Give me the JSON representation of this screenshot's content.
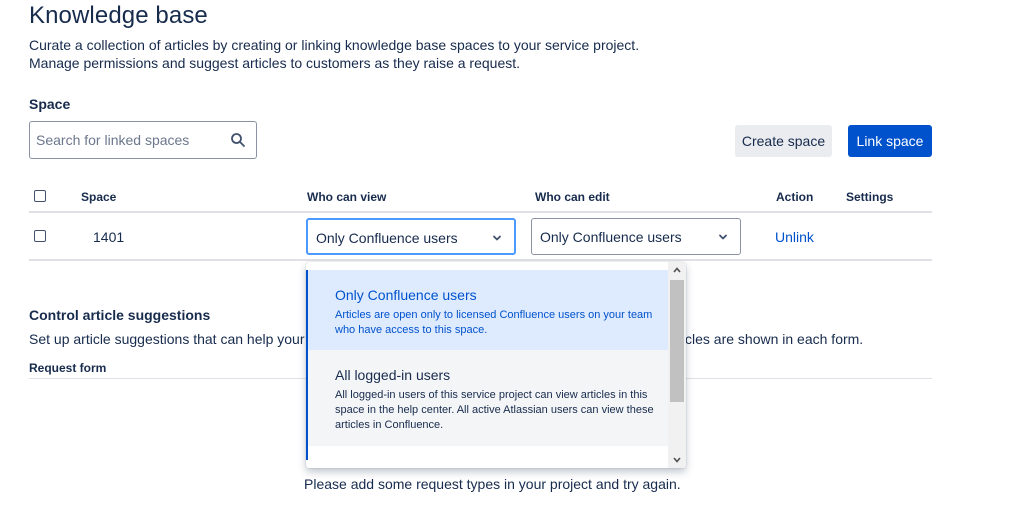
{
  "page": {
    "title": "Knowledge base",
    "description_line1": "Curate a collection of articles by creating or linking knowledge base spaces to your service project.",
    "description_line2": "Manage permissions and suggest articles to customers as they raise a request."
  },
  "space_section": {
    "label": "Space",
    "search_placeholder": "Search for linked spaces",
    "search_icon": "search-icon",
    "create_button": "Create space",
    "link_button": "Link space"
  },
  "table": {
    "headers": {
      "space": "Space",
      "who_can_view": "Who can view",
      "who_can_edit": "Who can edit",
      "action": "Action",
      "settings": "Settings"
    },
    "rows": [
      {
        "space": "1401",
        "who_can_view": "Only Confluence users",
        "who_can_edit": "Only Confluence users",
        "action": "Unlink"
      }
    ]
  },
  "dropdown": {
    "options": [
      {
        "title": "Only Confluence users",
        "description": "Articles are open only to licensed Confluence users on your team who have access to this space.",
        "selected": true
      },
      {
        "title": "All logged-in users",
        "description": "All logged-in users of this service project can view articles in this space in the help center. All active Atlassian users can view these articles in Confluence.",
        "selected": false
      }
    ]
  },
  "suggestions": {
    "title": "Control article suggestions",
    "description_left": "Set up article suggestions that can help your cu",
    "description_right": "ticles are shown in each form.",
    "request_form_header": "Request form",
    "empty_message": "Please add some request types in your project and try again."
  },
  "colors": {
    "primary": "#0052cc",
    "text": "#172b4d",
    "selected_bg": "#deebff",
    "focus_border": "#4c9aff"
  }
}
